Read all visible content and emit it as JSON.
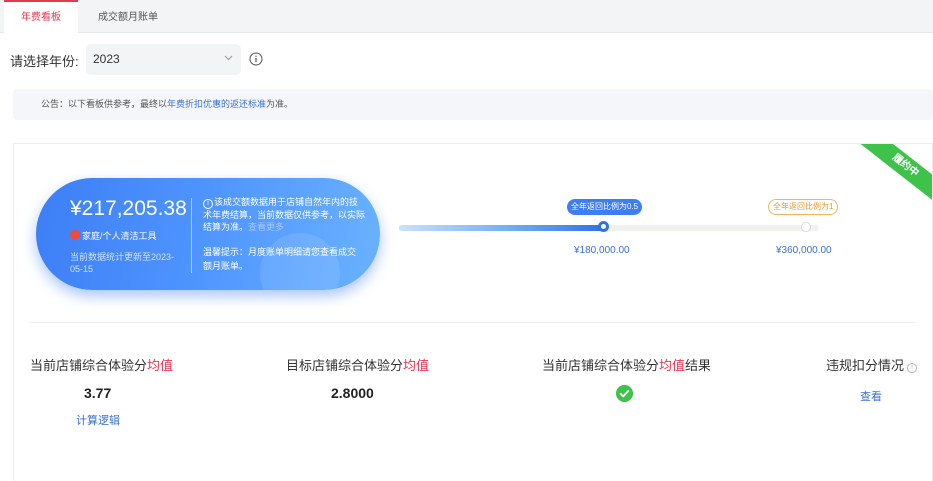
{
  "tabs": [
    {
      "label": "年费看板",
      "active": true
    },
    {
      "label": "成交额月账单",
      "active": false
    }
  ],
  "year_selector": {
    "label": "请选择年份:",
    "value": "2023"
  },
  "notice": {
    "prefix": "公告：以下看板供参考，最终以",
    "link": "年费折扣优惠的返还标准",
    "suffix": "为准。"
  },
  "status_ribbon": "履约中",
  "summary": {
    "amount": "¥217,205.38",
    "category": "家庭/个人清洁工具",
    "updated": "当前数据统计更新至2023-05-15",
    "desc_main": "该成交额数据用于店铺自然年内的技术年费结算，当前数据仅供参考，以实际结算为准。",
    "desc_more": "查看更多",
    "tip": "温馨提示：月度账单明细请您查看成交额月账单。"
  },
  "progress": {
    "fill_percent": 48.5,
    "milestones": [
      {
        "tag": "全年返回比例为0.5",
        "amount": "¥180,000.00"
      },
      {
        "tag": "全年返回比例为1",
        "amount": "¥360,000.00"
      }
    ]
  },
  "metrics": [
    {
      "title_pre": "当前店铺综合体验分",
      "title_hl": "均值",
      "title_post": "",
      "value": "3.77",
      "link": "计算逻辑"
    },
    {
      "title_pre": "目标店铺综合体验分",
      "title_hl": "均值",
      "title_post": "",
      "value": "2.8000"
    },
    {
      "title_pre": "当前店铺综合体验分",
      "title_hl": "均值",
      "title_post": "结果",
      "result_icon": "check-circle-icon"
    },
    {
      "title_pre": "违规扣分情况",
      "link": "查看"
    }
  ],
  "colors": {
    "accent_red": "#e8384d",
    "link_blue": "#3a6fd8",
    "capsule_blue": "#3d7ef5",
    "success_green": "#3ec24a",
    "warning_orange": "#e89a30"
  }
}
